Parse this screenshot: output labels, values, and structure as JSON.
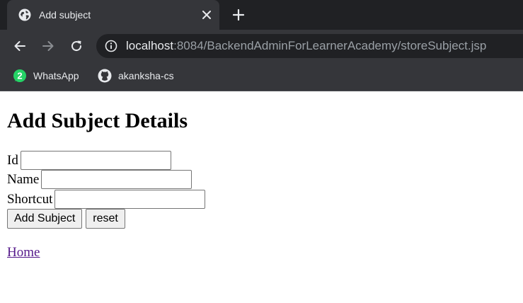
{
  "browser": {
    "tab": {
      "title": "Add subject",
      "favicon": "globe-icon"
    },
    "address": {
      "host": "localhost",
      "rest": ":8084/BackendAdminForLearnerAcademy/storeSubject.jsp"
    },
    "bookmarks": [
      {
        "label": "WhatsApp",
        "icon": "whatsapp-icon"
      },
      {
        "label": "akanksha-cs",
        "icon": "github-icon"
      }
    ],
    "colors": {
      "tabstrip": "#202124",
      "toolbar": "#35363a",
      "omnibox": "#202124",
      "text": "#e8eaed",
      "url_muted": "#9aa0a6",
      "whatsapp_green": "#25d366"
    }
  },
  "page": {
    "heading": "Add Subject Details",
    "form": {
      "fields": [
        {
          "label": "Id",
          "value": ""
        },
        {
          "label": "Name",
          "value": ""
        },
        {
          "label": "Shortcut",
          "value": ""
        }
      ],
      "submit_label": "Add Subject",
      "reset_label": "reset"
    },
    "home_link": "Home",
    "colors": {
      "visited_link": "#551a8b"
    }
  }
}
